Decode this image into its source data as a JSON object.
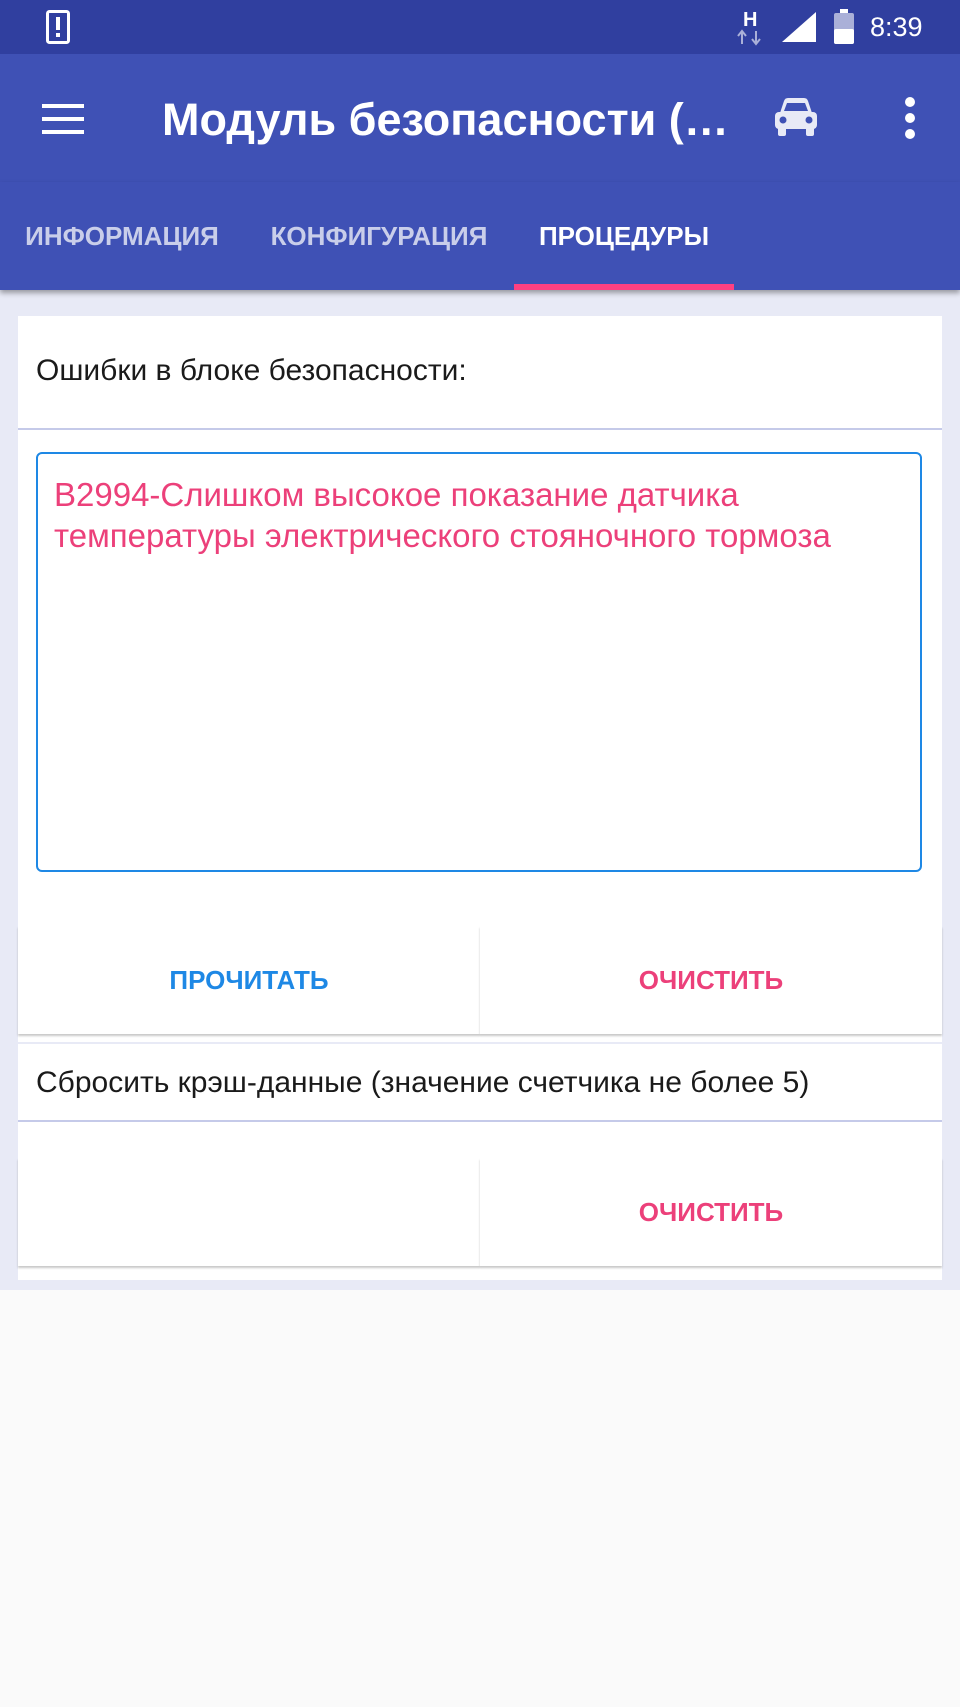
{
  "status_bar": {
    "time": "8:39",
    "network_type": "H",
    "icons": [
      "alert-icon",
      "network-h-icon",
      "signal-icon",
      "battery-icon"
    ]
  },
  "toolbar": {
    "title": "Модуль безопасности (R…",
    "icons": [
      "menu-icon",
      "car-icon",
      "more-vert-icon"
    ]
  },
  "tabs": [
    {
      "label": "ИНФОРМАЦИЯ",
      "active": false
    },
    {
      "label": "КОНФИГУРАЦИЯ",
      "active": false
    },
    {
      "label": "ПРОЦЕДУРЫ",
      "active": true
    }
  ],
  "errors_section": {
    "label": "Ошибки в блоке безопасности:",
    "error_text": "B2994-Слишком высокое показание датчика температуры электрического стояночного тормоза",
    "read_button": "ПРОЧИТАТЬ",
    "clear_button": "ОЧИСТИТЬ"
  },
  "crash_section": {
    "label": "Сбросить крэш-данные (значение счетчика не более 5)",
    "clear_button": "ОЧИСТИТЬ"
  },
  "colors": {
    "primary": "#3f51b5",
    "primary_dark": "#303f9f",
    "accent": "#ff4081",
    "blue_button": "#1e88e5",
    "pink_text": "#ec407a"
  }
}
